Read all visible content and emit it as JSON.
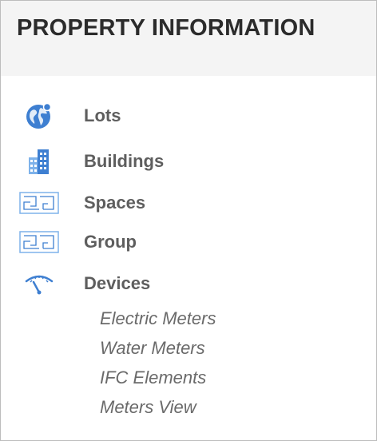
{
  "panel": {
    "title": "PROPERTY INFORMATION"
  },
  "menu": {
    "items": [
      {
        "label": "Lots",
        "icon": "globe-icon"
      },
      {
        "label": "Buildings",
        "icon": "building-icon"
      },
      {
        "label": "Spaces",
        "icon": "floorplan-icon"
      },
      {
        "label": "Group",
        "icon": "floorplan-icon"
      },
      {
        "label": "Devices",
        "icon": "meter-gauge-icon"
      }
    ],
    "device_subitems": [
      {
        "label": "Electric Meters"
      },
      {
        "label": "Water Meters"
      },
      {
        "label": "IFC Elements"
      },
      {
        "label": "Meters View"
      }
    ]
  },
  "colors": {
    "icon_blue": "#3e7fd1",
    "icon_light_blue": "#7eb2ea",
    "header_bg": "#f4f4f4",
    "label_text": "#5e5e5e",
    "title_text": "#2b2b2b"
  }
}
